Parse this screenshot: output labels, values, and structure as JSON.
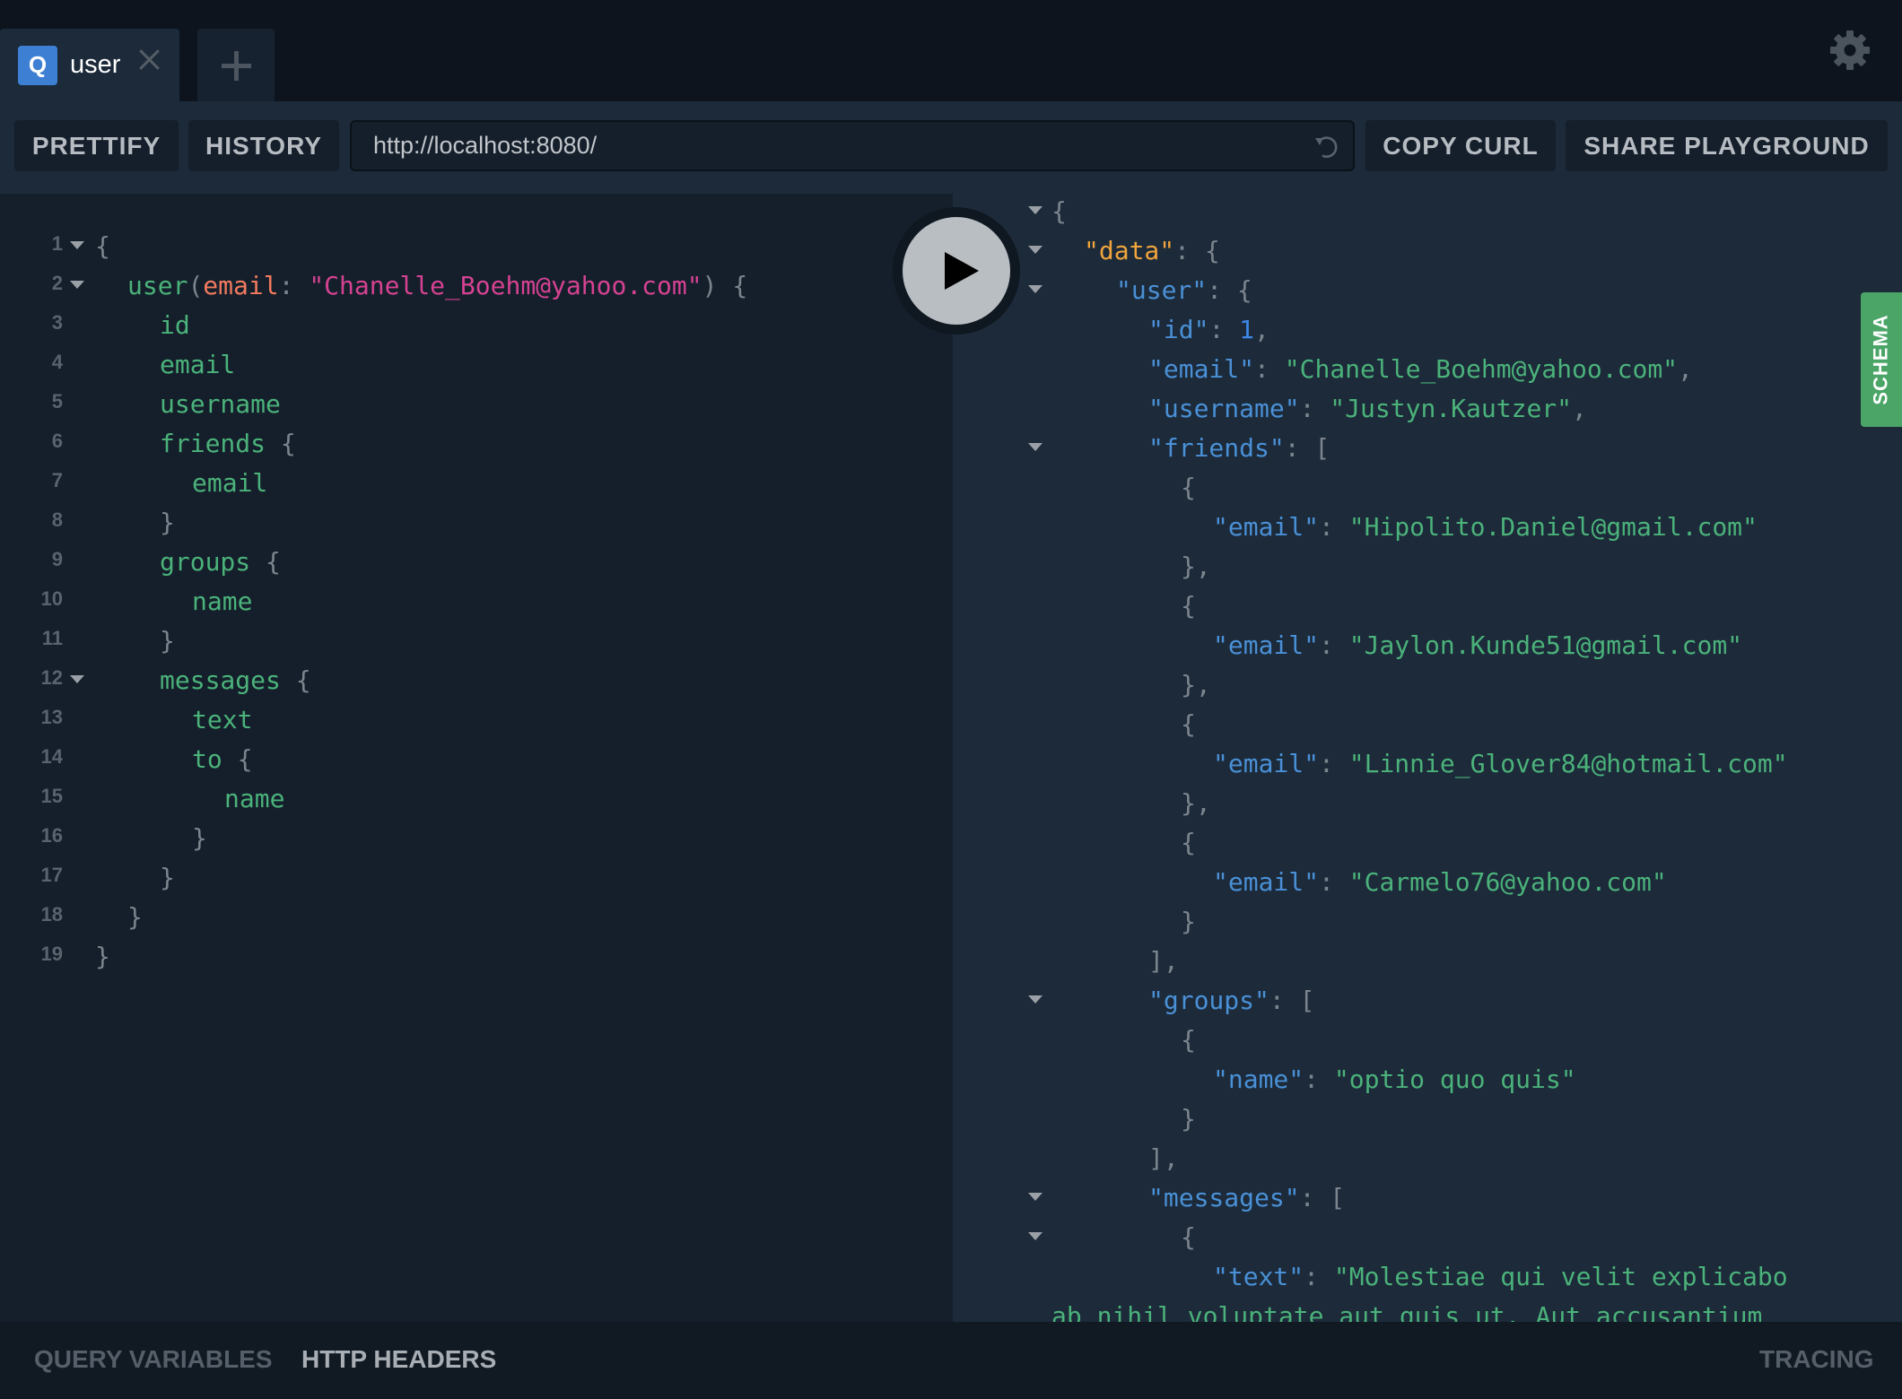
{
  "tabs": [
    {
      "badge": "Q",
      "title": "user",
      "close_icon": "close-icon"
    }
  ],
  "add_tab_icon": "plus-icon",
  "settings_icon": "gear-icon",
  "toolbar": {
    "prettify_label": "PRETTIFY",
    "history_label": "HISTORY",
    "endpoint_url": "http://localhost:8080/",
    "reload_icon": "reload-icon",
    "copy_curl_label": "COPY CURL",
    "share_label": "SHARE PLAYGROUND"
  },
  "editor": {
    "lines": [
      {
        "n": "1",
        "fold": true,
        "indent": 0,
        "tokens": [
          [
            "punc",
            "{"
          ]
        ]
      },
      {
        "n": "2",
        "fold": true,
        "indent": 1,
        "tokens": [
          [
            "kw-field",
            "user"
          ],
          [
            "punc",
            "("
          ],
          [
            "kw-arg",
            "email"
          ],
          [
            "punc",
            ": "
          ],
          [
            "kw-str",
            "\"Chanelle_Boehm@yahoo.com\""
          ],
          [
            "punc",
            ") {"
          ]
        ]
      },
      {
        "n": "3",
        "fold": false,
        "indent": 2,
        "tokens": [
          [
            "kw-field",
            "id"
          ]
        ]
      },
      {
        "n": "4",
        "fold": false,
        "indent": 2,
        "tokens": [
          [
            "kw-field",
            "email"
          ]
        ]
      },
      {
        "n": "5",
        "fold": false,
        "indent": 2,
        "tokens": [
          [
            "kw-field",
            "username"
          ]
        ]
      },
      {
        "n": "6",
        "fold": false,
        "indent": 2,
        "tokens": [
          [
            "kw-field",
            "friends"
          ],
          [
            "punc",
            " {"
          ]
        ]
      },
      {
        "n": "7",
        "fold": false,
        "indent": 3,
        "tokens": [
          [
            "kw-field",
            "email"
          ]
        ]
      },
      {
        "n": "8",
        "fold": false,
        "indent": 2,
        "tokens": [
          [
            "punc",
            "}"
          ]
        ]
      },
      {
        "n": "9",
        "fold": false,
        "indent": 2,
        "tokens": [
          [
            "kw-field",
            "groups"
          ],
          [
            "punc",
            " {"
          ]
        ]
      },
      {
        "n": "10",
        "fold": false,
        "indent": 3,
        "tokens": [
          [
            "kw-field",
            "name"
          ]
        ]
      },
      {
        "n": "11",
        "fold": false,
        "indent": 2,
        "tokens": [
          [
            "punc",
            "}"
          ]
        ]
      },
      {
        "n": "12",
        "fold": true,
        "indent": 2,
        "tokens": [
          [
            "kw-field",
            "messages"
          ],
          [
            "punc",
            " {"
          ]
        ]
      },
      {
        "n": "13",
        "fold": false,
        "indent": 3,
        "tokens": [
          [
            "kw-field",
            "text"
          ]
        ]
      },
      {
        "n": "14",
        "fold": false,
        "indent": 3,
        "tokens": [
          [
            "kw-field",
            "to"
          ],
          [
            "punc",
            " {"
          ]
        ]
      },
      {
        "n": "15",
        "fold": false,
        "indent": 4,
        "tokens": [
          [
            "kw-field",
            "name"
          ]
        ]
      },
      {
        "n": "16",
        "fold": false,
        "indent": 3,
        "tokens": [
          [
            "punc",
            "}"
          ]
        ]
      },
      {
        "n": "17",
        "fold": false,
        "indent": 2,
        "tokens": [
          [
            "punc",
            "}"
          ]
        ]
      },
      {
        "n": "18",
        "fold": false,
        "indent": 1,
        "tokens": [
          [
            "punc",
            "}"
          ]
        ]
      },
      {
        "n": "19",
        "fold": false,
        "indent": 0,
        "tokens": [
          [
            "punc",
            "}"
          ]
        ]
      }
    ]
  },
  "play_icon": "play-icon",
  "results": {
    "lines": [
      {
        "fold": true,
        "indent": 0,
        "tokens": [
          [
            "punc",
            "{"
          ]
        ]
      },
      {
        "fold": true,
        "indent": 1,
        "tokens": [
          [
            "j-root",
            "\"data\""
          ],
          [
            "punc",
            ": {"
          ]
        ]
      },
      {
        "fold": true,
        "indent": 2,
        "tokens": [
          [
            "j-key",
            "\"user\""
          ],
          [
            "punc",
            ": {"
          ]
        ]
      },
      {
        "fold": false,
        "indent": 3,
        "tokens": [
          [
            "j-key",
            "\"id\""
          ],
          [
            "punc",
            ": "
          ],
          [
            "j-num",
            "1"
          ],
          [
            "punc",
            ","
          ]
        ]
      },
      {
        "fold": false,
        "indent": 3,
        "tokens": [
          [
            "j-key",
            "\"email\""
          ],
          [
            "punc",
            ": "
          ],
          [
            "j-str",
            "\"Chanelle_Boehm@yahoo.com\""
          ],
          [
            "punc",
            ","
          ]
        ]
      },
      {
        "fold": false,
        "indent": 3,
        "tokens": [
          [
            "j-key",
            "\"username\""
          ],
          [
            "punc",
            ": "
          ],
          [
            "j-str",
            "\"Justyn.Kautzer\""
          ],
          [
            "punc",
            ","
          ]
        ]
      },
      {
        "fold": true,
        "indent": 3,
        "tokens": [
          [
            "j-key",
            "\"friends\""
          ],
          [
            "punc",
            ": ["
          ]
        ]
      },
      {
        "fold": false,
        "indent": 4,
        "tokens": [
          [
            "punc",
            "{"
          ]
        ]
      },
      {
        "fold": false,
        "indent": 5,
        "tokens": [
          [
            "j-key",
            "\"email\""
          ],
          [
            "punc",
            ": "
          ],
          [
            "j-str",
            "\"Hipolito.Daniel@gmail.com\""
          ]
        ]
      },
      {
        "fold": false,
        "indent": 4,
        "tokens": [
          [
            "punc",
            "},"
          ]
        ]
      },
      {
        "fold": false,
        "indent": 4,
        "tokens": [
          [
            "punc",
            "{"
          ]
        ]
      },
      {
        "fold": false,
        "indent": 5,
        "tokens": [
          [
            "j-key",
            "\"email\""
          ],
          [
            "punc",
            ": "
          ],
          [
            "j-str",
            "\"Jaylon.Kunde51@gmail.com\""
          ]
        ]
      },
      {
        "fold": false,
        "indent": 4,
        "tokens": [
          [
            "punc",
            "},"
          ]
        ]
      },
      {
        "fold": false,
        "indent": 4,
        "tokens": [
          [
            "punc",
            "{"
          ]
        ]
      },
      {
        "fold": false,
        "indent": 5,
        "tokens": [
          [
            "j-key",
            "\"email\""
          ],
          [
            "punc",
            ": "
          ],
          [
            "j-str",
            "\"Linnie_Glover84@hotmail.com\""
          ]
        ]
      },
      {
        "fold": false,
        "indent": 4,
        "tokens": [
          [
            "punc",
            "},"
          ]
        ]
      },
      {
        "fold": false,
        "indent": 4,
        "tokens": [
          [
            "punc",
            "{"
          ]
        ]
      },
      {
        "fold": false,
        "indent": 5,
        "tokens": [
          [
            "j-key",
            "\"email\""
          ],
          [
            "punc",
            ": "
          ],
          [
            "j-str",
            "\"Carmelo76@yahoo.com\""
          ]
        ]
      },
      {
        "fold": false,
        "indent": 4,
        "tokens": [
          [
            "punc",
            "}"
          ]
        ]
      },
      {
        "fold": false,
        "indent": 3,
        "tokens": [
          [
            "punc",
            "],"
          ]
        ]
      },
      {
        "fold": true,
        "indent": 3,
        "tokens": [
          [
            "j-key",
            "\"groups\""
          ],
          [
            "punc",
            ": ["
          ]
        ]
      },
      {
        "fold": false,
        "indent": 4,
        "tokens": [
          [
            "punc",
            "{"
          ]
        ]
      },
      {
        "fold": false,
        "indent": 5,
        "tokens": [
          [
            "j-key",
            "\"name\""
          ],
          [
            "punc",
            ": "
          ],
          [
            "j-str",
            "\"optio quo quis\""
          ]
        ]
      },
      {
        "fold": false,
        "indent": 4,
        "tokens": [
          [
            "punc",
            "}"
          ]
        ]
      },
      {
        "fold": false,
        "indent": 3,
        "tokens": [
          [
            "punc",
            "],"
          ]
        ]
      },
      {
        "fold": true,
        "indent": 3,
        "tokens": [
          [
            "j-key",
            "\"messages\""
          ],
          [
            "punc",
            ": ["
          ]
        ]
      },
      {
        "fold": true,
        "indent": 4,
        "tokens": [
          [
            "punc",
            "{"
          ]
        ]
      },
      {
        "fold": false,
        "indent": 5,
        "tokens": [
          [
            "j-key",
            "\"text\""
          ],
          [
            "punc",
            ": "
          ],
          [
            "j-str",
            "\"Molestiae qui velit explicabo"
          ]
        ]
      },
      {
        "fold": false,
        "indent": 0,
        "tokens": [
          [
            "j-str",
            "ab nihil voluptate aut quis ut. Aut accusantium"
          ]
        ]
      }
    ]
  },
  "schema_tab_label": "SCHEMA",
  "bottombar": {
    "query_variables_label": "QUERY VARIABLES",
    "http_headers_label": "HTTP HEADERS",
    "tracing_label": "TRACING"
  }
}
